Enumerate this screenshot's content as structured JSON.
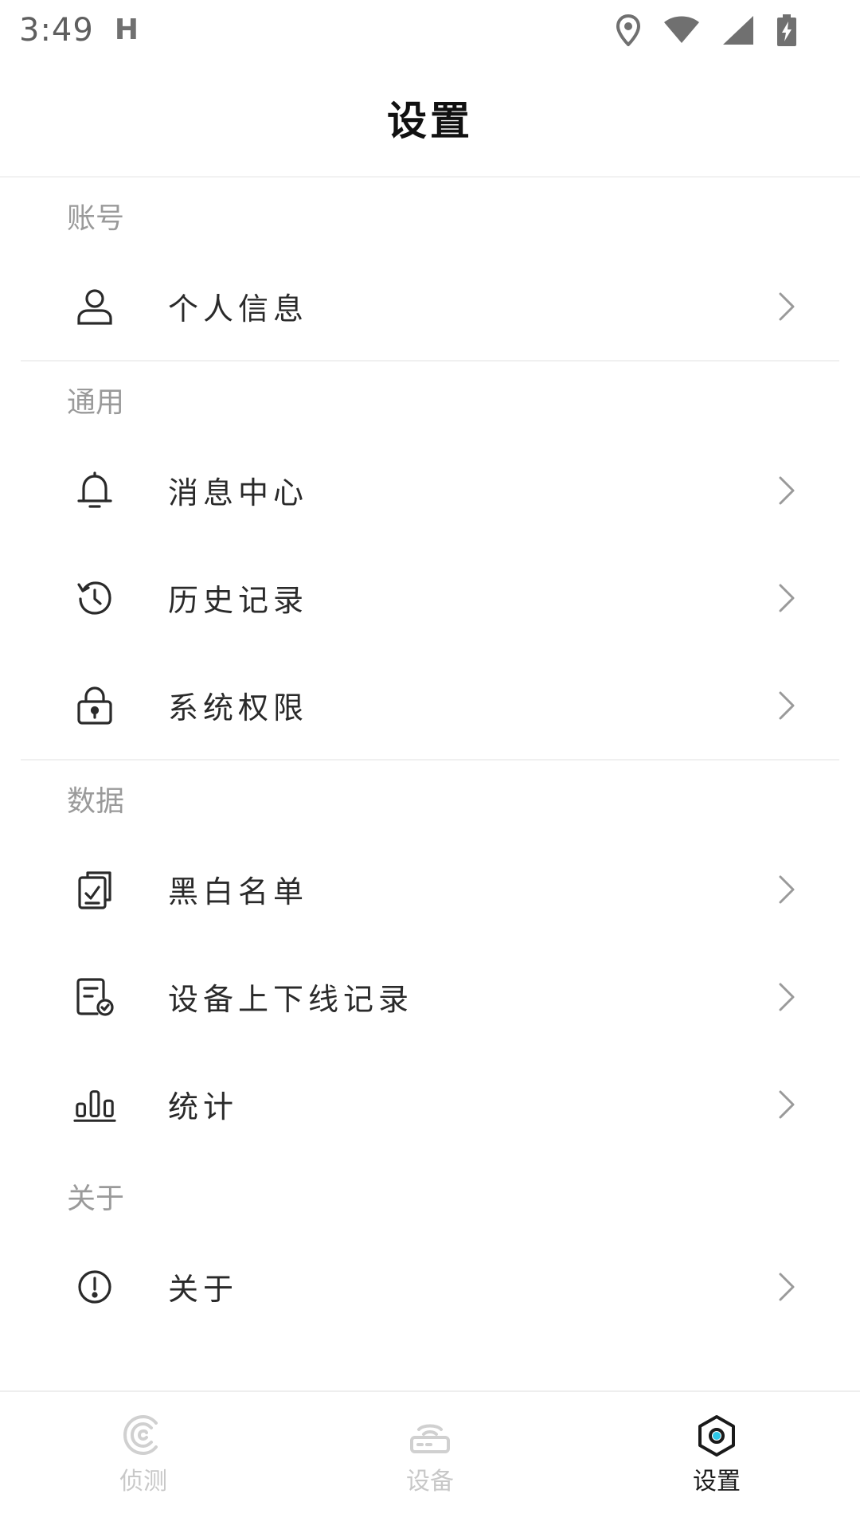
{
  "status_bar": {
    "time": "3:49",
    "indicator": "H",
    "icons": [
      "location-icon",
      "wifi-icon",
      "signal-icon",
      "battery-charging-icon"
    ]
  },
  "header": {
    "title": "设置"
  },
  "sections": [
    {
      "label": "账号",
      "items": [
        {
          "label": "个人信息",
          "icon": "user-icon"
        }
      ]
    },
    {
      "label": "通用",
      "items": [
        {
          "label": "消息中心",
          "icon": "bell-icon"
        },
        {
          "label": "历史记录",
          "icon": "history-icon"
        },
        {
          "label": "系统权限",
          "icon": "lock-icon"
        }
      ]
    },
    {
      "label": "数据",
      "items": [
        {
          "label": "黑白名单",
          "icon": "checklist-icon"
        },
        {
          "label": "设备上下线记录",
          "icon": "device-record-icon"
        },
        {
          "label": "统计",
          "icon": "bar-chart-icon"
        }
      ]
    },
    {
      "label": "关于",
      "items": [
        {
          "label": "关于",
          "icon": "info-icon"
        }
      ]
    }
  ],
  "bottom_nav": {
    "items": [
      {
        "label": "侦测",
        "icon": "detect-icon",
        "active": false
      },
      {
        "label": "设备",
        "icon": "router-icon",
        "active": false
      },
      {
        "label": "设置",
        "icon": "settings-hexagon-icon",
        "active": true
      }
    ],
    "active_color": "#1a1a1a",
    "accent_color": "#2ec7e6",
    "inactive_color": "#c8c8c8"
  }
}
